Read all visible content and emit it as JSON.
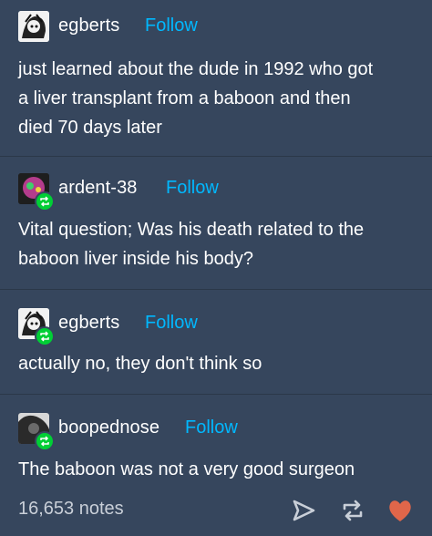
{
  "posts": [
    {
      "username": "egberts",
      "follow": "Follow",
      "text_lines": [
        "just learned about the dude in 1992 who got",
        "a liver transplant from a baboon and then",
        "died 70 days later"
      ]
    },
    {
      "username": "ardent-38",
      "follow": "Follow",
      "text_lines": [
        "Vital question; Was his death related to the",
        "baboon liver inside his body?"
      ]
    },
    {
      "username": "egberts",
      "follow": "Follow",
      "text_lines": [
        "actually no, they don't think so"
      ]
    },
    {
      "username": "boopednose",
      "follow": "Follow",
      "text_lines": [
        "The baboon was not a very good surgeon"
      ]
    }
  ],
  "footer": {
    "notes": "16,653 notes",
    "icons": [
      "share-icon",
      "reblog-icon",
      "like-heart-icon"
    ]
  },
  "colors": {
    "background": "#36465d",
    "follow": "#00b8ff",
    "reblog_badge": "#00cf35",
    "heart": "#e0664a",
    "notes": "#c9cfd8"
  }
}
